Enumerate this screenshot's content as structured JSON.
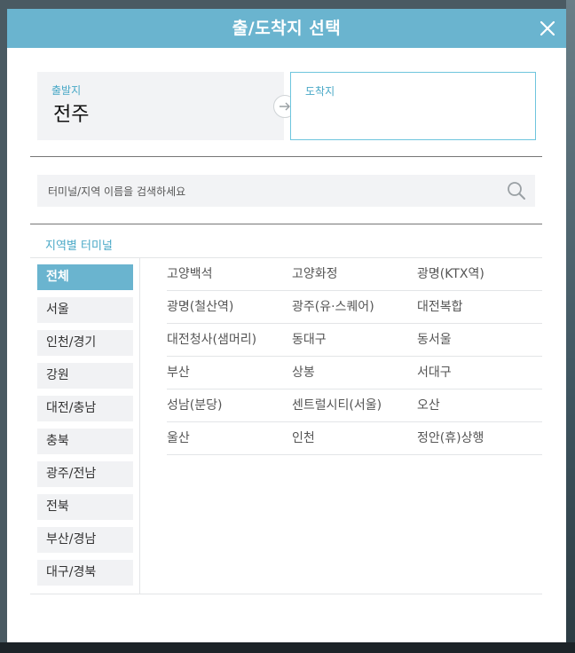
{
  "modal": {
    "title": "출/도착지 선택",
    "close_icon": "close-icon"
  },
  "route": {
    "departure": {
      "label": "출발지",
      "value": "전주"
    },
    "arrival": {
      "label": "도착지",
      "value": ""
    },
    "swap_icon": "arrow-right-icon"
  },
  "search": {
    "placeholder": "터미널/지역 이름을 검색하세요",
    "value": "",
    "icon": "search-icon"
  },
  "section": {
    "title": "지역별 터미널"
  },
  "regions": [
    {
      "label": "전체",
      "active": true
    },
    {
      "label": "서울",
      "active": false
    },
    {
      "label": "인천/경기",
      "active": false
    },
    {
      "label": "강원",
      "active": false
    },
    {
      "label": "대전/충남",
      "active": false
    },
    {
      "label": "충북",
      "active": false
    },
    {
      "label": "광주/전남",
      "active": false
    },
    {
      "label": "전북",
      "active": false
    },
    {
      "label": "부산/경남",
      "active": false
    },
    {
      "label": "대구/경북",
      "active": false
    }
  ],
  "terminals": [
    [
      "고양백석",
      "고양화정",
      "광명(KTX역)"
    ],
    [
      "광명(철산역)",
      "광주(유·스퀘어)",
      "대전복합"
    ],
    [
      "대전청사(샘머리)",
      "동대구",
      "동서울"
    ],
    [
      "부산",
      "상봉",
      "서대구"
    ],
    [
      "성남(분당)",
      "센트럴시티(서울)",
      "오산"
    ],
    [
      "울산",
      "인천",
      "정안(휴)상행"
    ]
  ],
  "colors": {
    "accent": "#6ab4cf",
    "label": "#4aa9c7",
    "panel": "#f2f3f5"
  }
}
